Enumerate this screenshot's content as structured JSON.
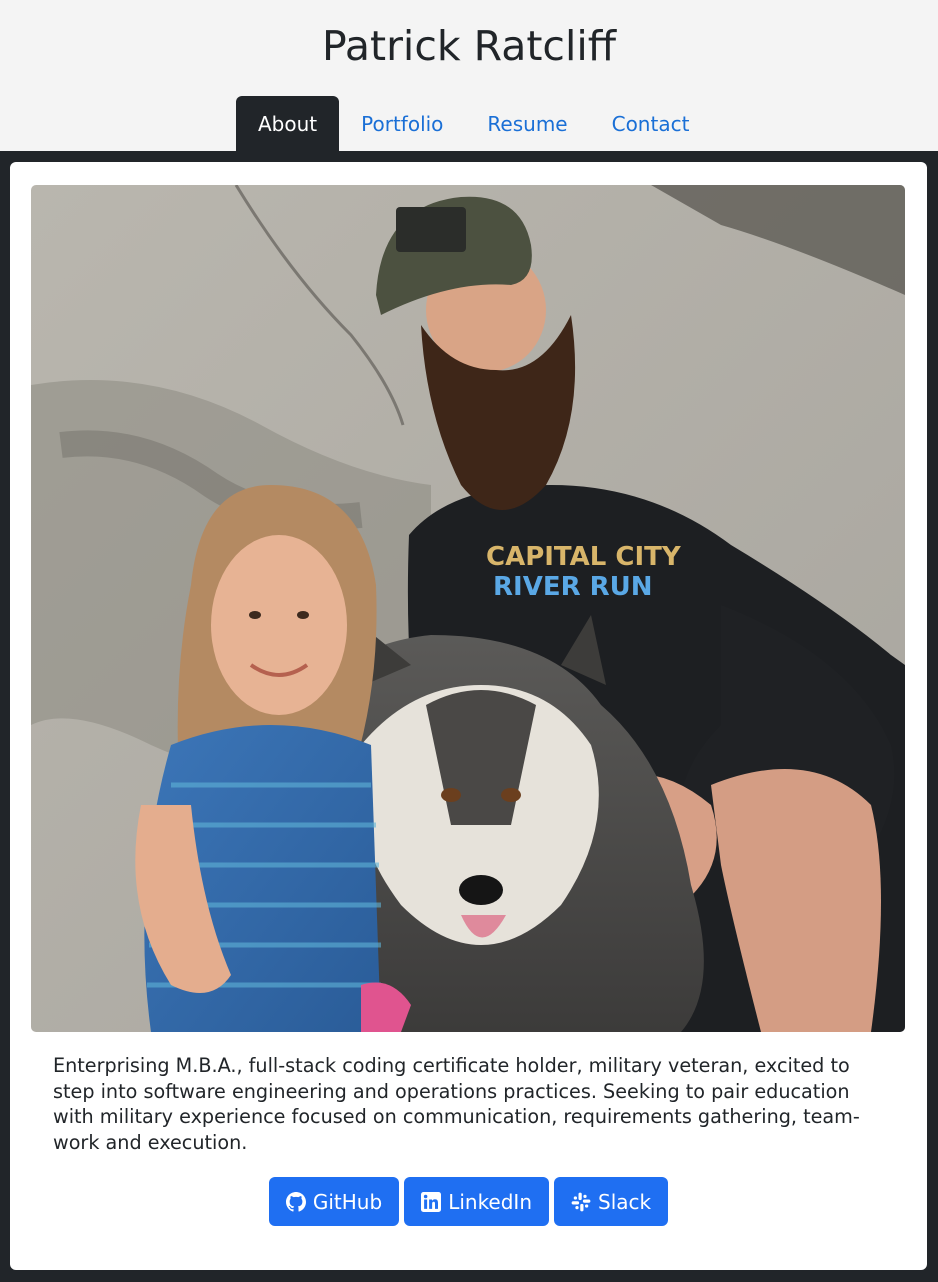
{
  "header": {
    "title": "Patrick Ratcliff"
  },
  "nav": {
    "tabs": [
      {
        "label": "About",
        "active": true
      },
      {
        "label": "Portfolio",
        "active": false
      },
      {
        "label": "Resume",
        "active": false
      },
      {
        "label": "Contact",
        "active": false
      }
    ]
  },
  "about": {
    "bio": "Enterprising M.B.A., full-stack coding certificate holder, military veteran, excited to step into software engineering and operations practices. Seeking to pair education with military experience focused on communication, requirements gathering, team-work and execution.",
    "links": [
      {
        "label": "GitHub",
        "icon": "github-icon"
      },
      {
        "label": "LinkedIn",
        "icon": "linkedin-icon"
      },
      {
        "label": "Slack",
        "icon": "slack-icon"
      }
    ]
  },
  "colors": {
    "accent": "#1f6ff2",
    "link": "#1a6fd6",
    "dark": "#212529",
    "header_bg": "#f4f4f4"
  }
}
